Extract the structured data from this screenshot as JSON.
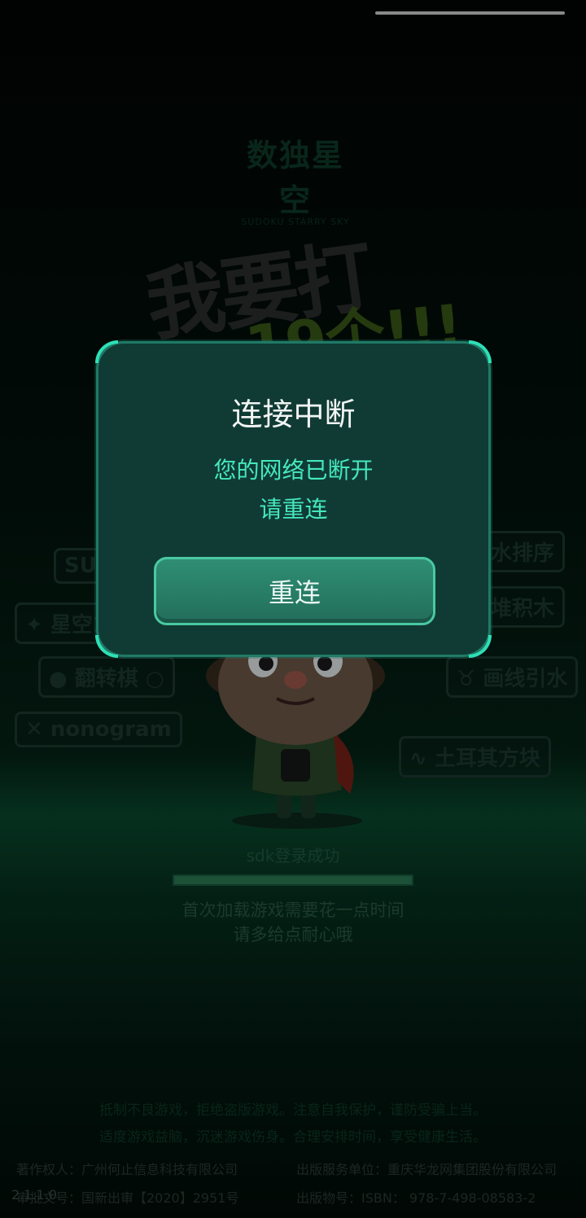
{
  "logo": {
    "name_cn": "数独星空",
    "name_en": "SUDOKU STARRY SKY"
  },
  "banner": {
    "line1": "我要打",
    "line2": "19个!!!"
  },
  "game_tags": [
    {
      "label": "SUDOKU",
      "icon": ""
    },
    {
      "label": "水排序",
      "icon": ""
    },
    {
      "label": "星空100",
      "icon": "star-icon"
    },
    {
      "label": "堆积木",
      "icon": ""
    },
    {
      "label": "翻转棋",
      "icon": "circle-icon"
    },
    {
      "label": "画线引水",
      "icon": "water-icon"
    },
    {
      "label": "nonogram",
      "icon": "cross-icon"
    },
    {
      "label": "土耳其方块",
      "icon": "snake-icon"
    }
  ],
  "loading": {
    "status": "sdk登录成功",
    "progress": 1.0,
    "tip_line1": "首次加载游戏需要花一点时间",
    "tip_line2": "请多给点耐心哦"
  },
  "health_notice": {
    "line1": "抵制不良游戏，拒绝盗版游戏。注意自我保护，谨防受骗上当。",
    "line2": "适度游戏益脑，沉迷游戏伤身。合理安排时间，享受健康生活。"
  },
  "copyright": {
    "owner": "著作权人：广州何止信息科技有限公司",
    "approval": "审批文号：国新出审【2020】2951号",
    "version": "2.1.1.0",
    "publisher": "出版服务单位：重庆华龙网集团股份有限公司",
    "isbn": "出版物号：ISBN： 978-7-498-08583-2"
  },
  "dialog": {
    "title": "连接中断",
    "message_line1": "您的网络已断开",
    "message_line2": "请重连",
    "button_label": "重连"
  },
  "colors": {
    "accent": "#45e8bb",
    "modal_bg": "#103b34",
    "button": "#2f8e74"
  }
}
